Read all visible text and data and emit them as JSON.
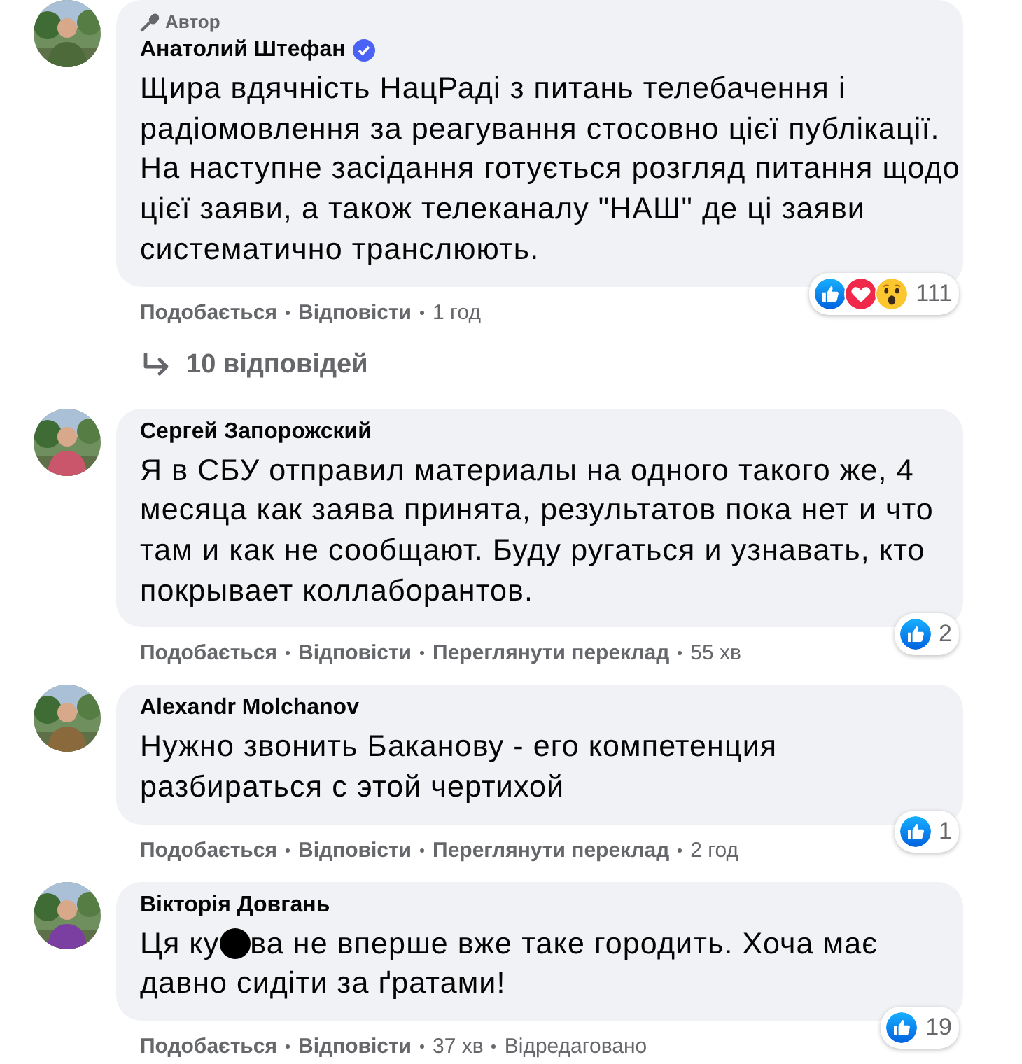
{
  "comments": [
    {
      "author": "Анатолий Штефан",
      "badge": "Автор",
      "verified": true,
      "text_parts": [
        "Щира вдячність НацРаді з питань телебачення і радіомовлення за реагування стосовно цієї публікації. На наступне засідання готується розгляд питання щодо цієї заяви, а також телеканалу \"НАШ\" де ці заяви систематично транслюють."
      ],
      "actions": [
        "Подобається",
        "Відповісти"
      ],
      "time": "1 год",
      "reactions": [
        {
          "kind": "like"
        },
        {
          "kind": "love"
        },
        {
          "kind": "wow"
        }
      ],
      "reaction_count": "111",
      "replies": "10 відповідей"
    },
    {
      "author": "Сергей Запорожский",
      "text_parts": [
        "Я в СБУ отправил материалы на одного такого же, 4 месяца как заява принята, результатов пока нет и что там и как не сообщают. Буду ругаться и узнавать, кто покрывает коллаборантов."
      ],
      "actions": [
        "Подобається",
        "Відповісти",
        "Переглянути переклад"
      ],
      "time": "55 хв",
      "reactions": [
        {
          "kind": "like"
        }
      ],
      "reaction_count": "2"
    },
    {
      "author": "Alexandr Molchanov",
      "text_parts": [
        "Нужно звонить Баканову - его компетенция разбираться с этой чертихой"
      ],
      "actions": [
        "Подобається",
        "Відповісти",
        "Переглянути переклад"
      ],
      "time": "2 год",
      "reactions": [
        {
          "kind": "like"
        }
      ],
      "reaction_count": "1"
    },
    {
      "author": "Вікторія Довгань",
      "text_parts": [
        "Ця ку",
        "ва не вперше вже таке городить. Хоча має",
        "давно сидіти за ґратами!"
      ],
      "redacted": true,
      "actions": [
        "Подобається",
        "Відповісти"
      ],
      "time": "37 хв",
      "edited": "Відредаговано",
      "reactions": [
        {
          "kind": "like"
        }
      ],
      "reaction_count": "19"
    }
  ]
}
